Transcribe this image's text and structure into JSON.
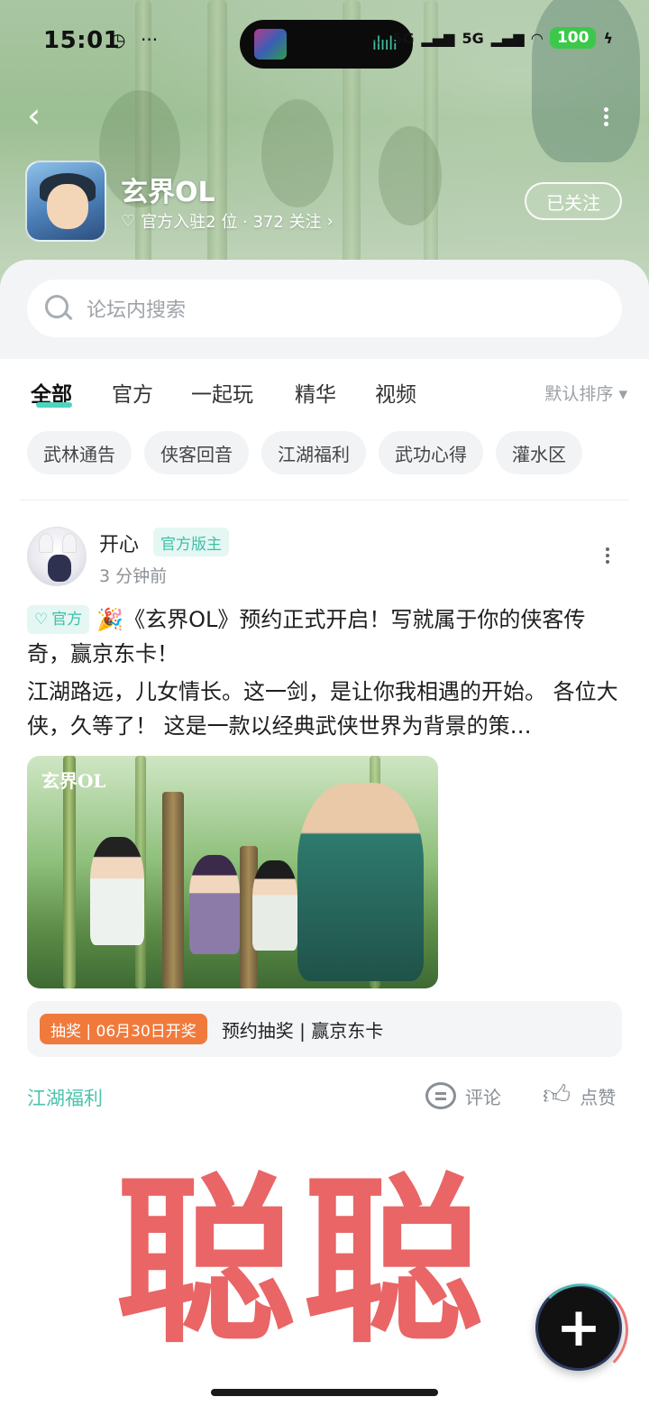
{
  "status": {
    "time": "15:01",
    "network1": "5G",
    "network2": "5G",
    "battery": "100"
  },
  "header": {
    "game_title": "玄界OL",
    "meta": "官方入驻2 位 · 372 关注",
    "follow_label": "已关注"
  },
  "search": {
    "placeholder": "论坛内搜索"
  },
  "tabs": [
    {
      "label": "全部"
    },
    {
      "label": "官方"
    },
    {
      "label": "一起玩"
    },
    {
      "label": "精华"
    },
    {
      "label": "视频"
    }
  ],
  "sort_label": "默认排序",
  "chips": [
    "武林通告",
    "侠客回音",
    "江湖福利",
    "武功心得",
    "灌水区"
  ],
  "post": {
    "author": "开心",
    "role": "官方版主",
    "time_ago": "3 分钟前",
    "badge": "官方",
    "title": "🎉《玄界OL》预约正式开启！写就属于你的侠客传奇，赢京东卡！",
    "body": "江湖路远，儿女情长。这一剑，是让你我相遇的开始。 各位大侠，久等了！ 这是一款以经典武侠世界为背景的策…",
    "image_logo": "玄界OL",
    "lottery_tag": "抽奖 | 06月30日开奖",
    "lottery_text": "预约抽奖 | 赢京东卡",
    "topic": "江湖福利",
    "comment_label": "评论",
    "like_label": "点赞"
  },
  "watermark": "聪聪",
  "colors": {
    "accent": "#4fd3bf",
    "lottery": "#f07a3c",
    "watermark": "#e8595a"
  },
  "icons": [
    "back-icon",
    "more-icon",
    "diamond-icon",
    "chevron-right-icon",
    "search-icon",
    "comment-icon",
    "like-icon",
    "plus-icon"
  ]
}
